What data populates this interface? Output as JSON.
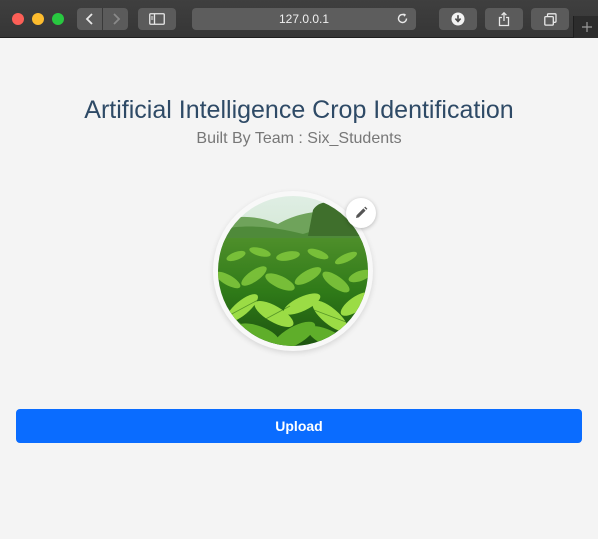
{
  "browser": {
    "url": "127.0.0.1",
    "icons": {
      "close": "close-window-icon",
      "minimize": "minimize-window-icon",
      "maximize": "maximize-window-icon",
      "back": "chevron-left-icon",
      "forward": "chevron-right-icon",
      "sidebar": "sidebar-icon",
      "reload": "reload-icon",
      "downloads": "download-icon",
      "share": "share-icon",
      "tabs": "tabs-overview-icon",
      "new_tab": "plus-icon"
    }
  },
  "page": {
    "title": "Artificial Intelligence Crop Identification",
    "subtitle": "Built By Team : Six_Students",
    "upload_label": "Upload",
    "edit_icon": "pencil-icon"
  },
  "colors": {
    "title": "#2e4a66",
    "upload_button": "#0a6cff",
    "page_background": "#f4f4f4"
  }
}
